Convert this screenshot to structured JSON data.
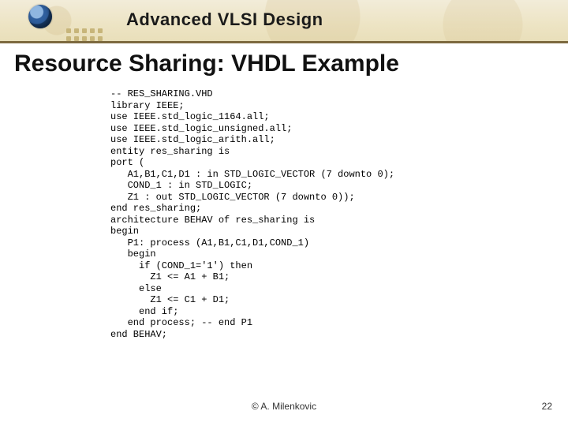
{
  "header": {
    "course_title": "Advanced VLSI Design"
  },
  "slide": {
    "title": "Resource Sharing: VHDL Example"
  },
  "code": {
    "text": "-- RES_SHARING.VHD\nlibrary IEEE;\nuse IEEE.std_logic_1164.all;\nuse IEEE.std_logic_unsigned.all;\nuse IEEE.std_logic_arith.all;\nentity res_sharing is\nport (\n   A1,B1,C1,D1 : in STD_LOGIC_VECTOR (7 downto 0);\n   COND_1 : in STD_LOGIC;\n   Z1 : out STD_LOGIC_VECTOR (7 downto 0));\nend res_sharing;\narchitecture BEHAV of res_sharing is\nbegin\n   P1: process (A1,B1,C1,D1,COND_1)\n   begin\n     if (COND_1='1') then\n       Z1 <= A1 + B1;\n     else\n       Z1 <= C1 + D1;\n     end if;\n   end process; -- end P1\nend BEHAV;"
  },
  "footer": {
    "copyright": "© A. Milenkovic",
    "page_number": "22"
  }
}
